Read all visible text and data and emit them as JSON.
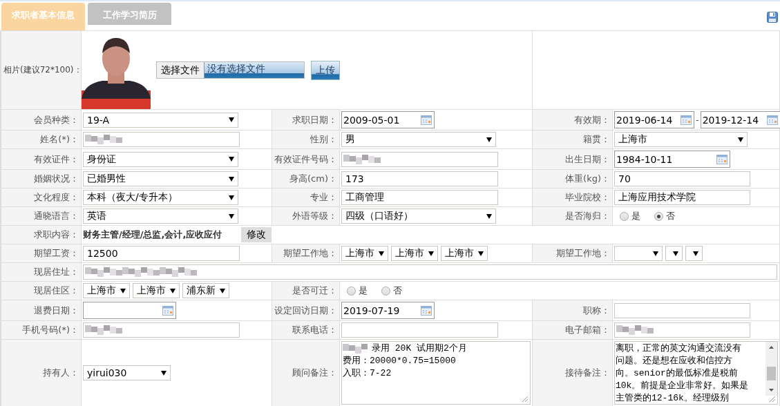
{
  "tabs": [
    {
      "label": "求职者基本信息",
      "selected": true
    },
    {
      "label": "工作学习简历",
      "selected": false
    }
  ],
  "photo_row": {
    "label": "相片(建议72*100)：",
    "file_button": "选择文件",
    "file_status": "没有选择文件",
    "upload_button": "上传"
  },
  "rows": [
    {
      "cells": [
        {
          "label": "会员种类：",
          "kind": "select",
          "value": "19-A"
        },
        {
          "label": "求职日期：",
          "kind": "date",
          "value": "2009-05-01"
        },
        {
          "label": "有效期：",
          "kind": "daterange",
          "value": "2019-06-14",
          "separator": "-",
          "value_to": "2019-12-14"
        }
      ]
    },
    {
      "cells": [
        {
          "label": "姓名(*)：",
          "kind": "blurred"
        },
        {
          "label": "性别：",
          "kind": "select",
          "value": "男"
        },
        {
          "label": "籍贯：",
          "kind": "select",
          "value": "上海市"
        }
      ]
    },
    {
      "cells": [
        {
          "label": "有效证件：",
          "kind": "select",
          "value": "身份证"
        },
        {
          "label": "有效证件号码：",
          "kind": "blurred"
        },
        {
          "label": "出生日期：",
          "kind": "date",
          "value": "1984-10-11"
        }
      ]
    },
    {
      "cells": [
        {
          "label": "婚姻状况：",
          "kind": "select",
          "value": "已婚男性"
        },
        {
          "label": "身高(cm)：",
          "kind": "text",
          "value": "173"
        },
        {
          "label": "体重(kg)：",
          "kind": "text",
          "value": "70"
        }
      ]
    },
    {
      "cells": [
        {
          "label": "文化程度：",
          "kind": "select",
          "value": "本科（夜大/专升本）"
        },
        {
          "label": "专业：",
          "kind": "text",
          "value": "工商管理"
        },
        {
          "label": "毕业院校：",
          "kind": "text",
          "value": "上海应用技术学院"
        }
      ]
    },
    {
      "cells": [
        {
          "label": "通晓语言：",
          "kind": "select",
          "value": "英语"
        },
        {
          "label": "外语等级：",
          "kind": "select",
          "value": "四级（口语好）"
        },
        {
          "label": "是否海归：",
          "kind": "radio",
          "options": [
            {
              "label": "是",
              "selected": false
            },
            {
              "label": "否",
              "selected": true
            }
          ]
        }
      ]
    },
    {
      "cells": [
        {
          "label": "求职内容：",
          "kind": "job",
          "value": "财务主管/经理/总监,会计,应收应付",
          "button": "修改"
        }
      ]
    },
    {
      "cells": [
        {
          "label": "期望工资：",
          "kind": "text",
          "value": "12500"
        },
        {
          "label": "期望工作地：",
          "kind": "selects",
          "selects": [
            {
              "text": "上海市"
            },
            {
              "text": "上海市"
            },
            {
              "text": "上海市"
            }
          ]
        },
        {
          "label": "期望工作地：",
          "kind": "selects",
          "selects": [
            {
              "empty": true
            },
            {
              "empty": true
            },
            {
              "empty": true
            }
          ]
        }
      ]
    },
    {
      "cells": [
        {
          "label": "现居住址：",
          "kind": "blurred"
        }
      ]
    },
    {
      "cells": [
        {
          "label": "现居住区：",
          "kind": "selects",
          "selects": [
            {
              "text": "上海市"
            },
            {
              "text": "上海市"
            },
            {
              "text": "浦东新"
            }
          ]
        },
        {
          "label": "是否可迁：",
          "kind": "radio",
          "options": [
            {
              "label": "是",
              "selected": false
            },
            {
              "label": "否",
              "selected": false
            }
          ]
        }
      ]
    },
    {
      "cells": [
        {
          "label": "退费日期：",
          "kind": "date"
        },
        {
          "label": "设定回访日期：",
          "kind": "date",
          "value": "2019-07-19"
        },
        {
          "label": "职称：",
          "kind": "text"
        }
      ]
    },
    {
      "cells": [
        {
          "label": "手机号码(*)：",
          "kind": "blurred"
        },
        {
          "label": "联系电话：",
          "kind": "text"
        },
        {
          "label": "电子邮箱：",
          "kind": "blurred"
        }
      ]
    },
    {
      "cells": [
        {
          "label": "持有人：",
          "kind": "select",
          "value": "yirui030"
        },
        {
          "label": "顾问备注：",
          "kind": "textarea",
          "blurred_start": true,
          "lines": [
            "录用 20K 试用期2个月",
            "费用：20000*0.75=15000",
            "入职：7-22"
          ]
        },
        {
          "label": "接待备注：",
          "kind": "textarea",
          "scrollbar": true,
          "lines": [
            "离职，正常的英文沟通交流没有",
            "问题。还是想在应收和信控方",
            "向。senior的最低标准是税前",
            "10k。前提是企业非常好。如果是",
            "主管类的12-16k。经理级别"
          ]
        }
      ]
    }
  ]
}
